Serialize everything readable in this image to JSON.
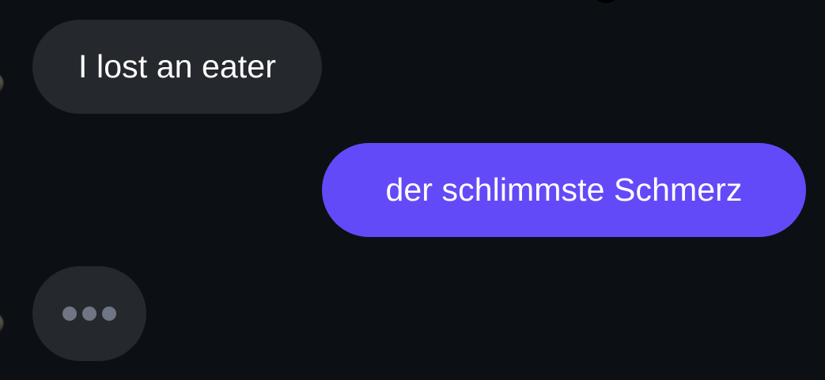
{
  "messages": [
    {
      "direction": "incoming",
      "text": "I lost an eater"
    },
    {
      "direction": "outgoing",
      "text": "der schlimmste Schmerz"
    }
  ],
  "typing_indicator": {
    "visible": true,
    "dot_count": 3
  },
  "colors": {
    "background": "#0c1015",
    "incoming_bubble": "#25282d",
    "outgoing_bubble": "#634af8",
    "message_text": "#ffffff",
    "typing_dot": "#6f7582"
  }
}
